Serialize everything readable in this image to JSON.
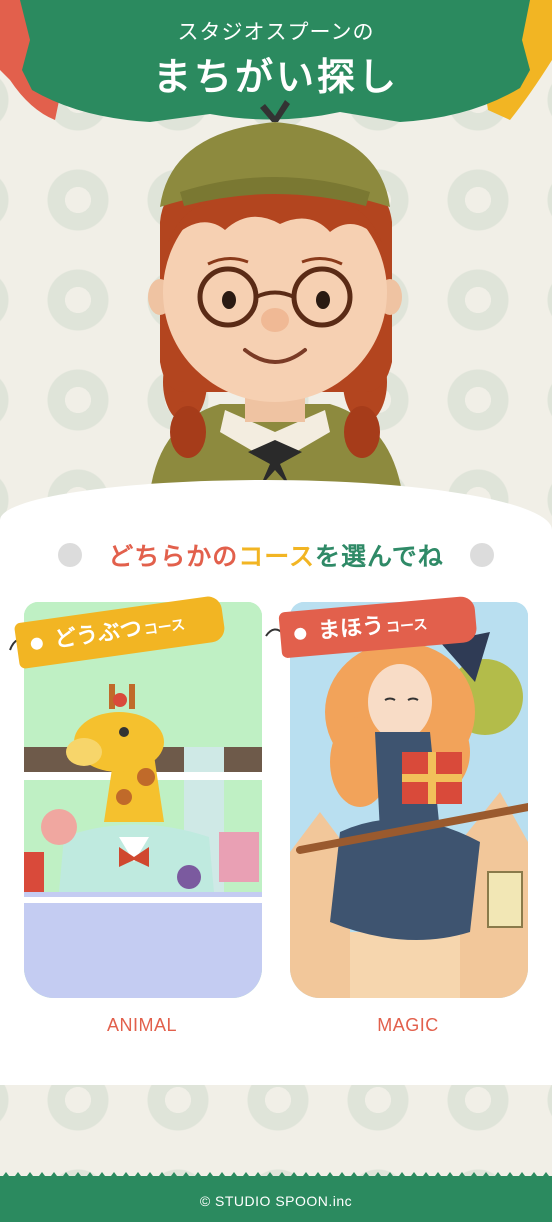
{
  "header": {
    "subtitle": "スタジオスプーンの",
    "title": "まちがい探し"
  },
  "main": {
    "heading_part1": "どちらかの",
    "heading_part2": "コース",
    "heading_part3": "を選んでね",
    "courses": [
      {
        "tag_label": "どうぶつ",
        "tag_suffix": "コース",
        "label": "ANIMAL",
        "tag_color": "#f2b523"
      },
      {
        "tag_label": "まほう",
        "tag_suffix": "コース",
        "label": "MAGIC",
        "tag_color": "#e2604c"
      }
    ]
  },
  "footer": {
    "copyright": "© STUDIO SPOON.inc"
  },
  "colors": {
    "brand_green": "#2b8a5f",
    "accent_red": "#e2604c",
    "accent_yellow": "#f2b523",
    "background": "#f1efe7"
  }
}
